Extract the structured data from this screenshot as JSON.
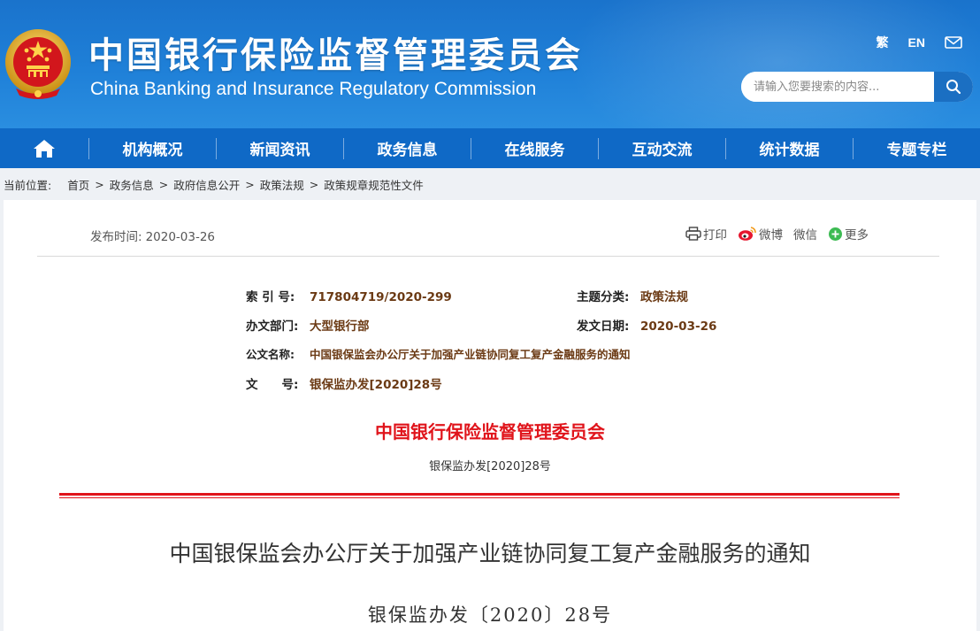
{
  "header": {
    "title_cn": "中国银行保险监督管理委员会",
    "title_en": "China Banking and Insurance Regulatory Commission",
    "links": {
      "traditional": "繁",
      "english": "EN"
    },
    "search_placeholder": "请输入您要搜索的内容...",
    "colors": {
      "header_bg": "#1f80d8",
      "nav_bg": "#0f69c6"
    }
  },
  "nav": {
    "items": [
      "机构概况",
      "新闻资讯",
      "政务信息",
      "在线服务",
      "互动交流",
      "统计数据",
      "专题专栏"
    ]
  },
  "breadcrumb": {
    "label": "当前位置:",
    "items": [
      "首页",
      "政务信息",
      "政府信息公开",
      "政策法规",
      "政策规章规范性文件"
    ]
  },
  "article": {
    "pub_label": "发布时间:",
    "pub_date": "2020-03-26",
    "share": {
      "print": "打印",
      "weibo": "微博",
      "wechat": "微信",
      "more": "更多"
    },
    "info": {
      "index_key": "索 引 号:",
      "index_val": "717804719/2020-299",
      "topic_key": "主题分类:",
      "topic_val": "政策法规",
      "dept_key": "办文部门:",
      "dept_val": "大型银行部",
      "date_key": "发文日期:",
      "date_val": "2020-03-26",
      "name_key": "公文名称:",
      "name_val": "中国银保监会办公厅关于加强产业链协同复工复产金融服务的通知",
      "no_key": "文　　号:",
      "no_val": "银保监办发[2020]28号"
    },
    "org_title": "中国银行保险监督管理委员会",
    "doc_no_small": "银保监办发[2020]28号",
    "doc_title": "中国银保监会办公厅关于加强产业链协同复工复产金融服务的通知",
    "doc_no_big": "银保监办发〔2020〕28号",
    "accent_red": "#e0141b"
  }
}
